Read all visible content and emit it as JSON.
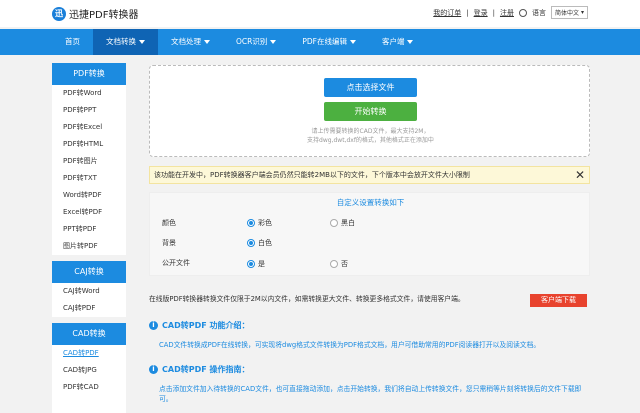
{
  "header": {
    "logo_mark": "迅",
    "app_title": "迅捷PDF转换器",
    "links": [
      "我的订单",
      "登录",
      "注册"
    ],
    "lang_label": "语言",
    "lang_value": "简体中文"
  },
  "nav": {
    "items": [
      {
        "label": "首页",
        "caret": false
      },
      {
        "label": "文档转换",
        "caret": true
      },
      {
        "label": "文档处理",
        "caret": true
      },
      {
        "label": "OCR识别",
        "caret": true
      },
      {
        "label": "PDF在线编辑",
        "caret": true
      },
      {
        "label": "客户端",
        "caret": true
      }
    ]
  },
  "sidebar": {
    "groups": [
      {
        "title": "PDF转换",
        "items": [
          "PDF转Word",
          "PDF转PPT",
          "PDF转Excel",
          "PDF转HTML",
          "PDF转图片",
          "PDF转TXT",
          "Word转PDF",
          "Excel转PDF",
          "PPT转PDF",
          "图片转PDF"
        ]
      },
      {
        "title": "CAJ转换",
        "items": [
          "CAJ转Word",
          "CAJ转PDF"
        ]
      },
      {
        "title": "CAD转换",
        "items": [
          "CAD转PDF",
          "CAD转JPG",
          "PDF转CAD"
        ]
      }
    ]
  },
  "upload": {
    "select_label": "点击选择文件",
    "convert_label": "开始转换",
    "hint_line1": "请上传需要转换的CAD文件，最大支持2M，",
    "hint_line2": "支持dwg,dwt,dxf的格式，其他格式正在添加中"
  },
  "notice": {
    "text": "该功能在开发中，PDF转换器客户端会员仍然只能转2MB以下的文件，下个版本中会放开文件大小限制"
  },
  "settings": {
    "title": "自定义设置转换如下",
    "color_label": "颜色",
    "color_opt1": "彩色",
    "color_opt2": "黑白",
    "bg_label": "背景",
    "bg_opt1": "白色",
    "public_label": "公开文件",
    "public_opt1": "是",
    "public_opt2": "否"
  },
  "online_note": {
    "text": "在线版PDF转换器转换文件仅限于2M以内文件，如需转换更大文件、转换更多格式文件，请使用客户端。",
    "download_label": "客户端下载"
  },
  "intro": {
    "title": "CAD转PDF 功能介绍：",
    "text": "CAD文件转换成PDF在线转换，可实现将dwg格式文件转换为PDF格式文档，用户可借助常用的PDF阅读器打开以及阅读文档。"
  },
  "guide": {
    "title": "CAD转PDF 操作指南：",
    "text": "点击添加文件加入待转换的CAD文件，也可直接拖动添加，点击开始转换，我们将自动上传转换文件，您只需稍等片刻将转换后的文件下载即可。"
  },
  "colors": {
    "primary": "#1c8be0",
    "nav_active": "#0f64b4",
    "convert": "#4cb040",
    "download": "#e8432e",
    "notice_bg": "#fdf8d8"
  }
}
